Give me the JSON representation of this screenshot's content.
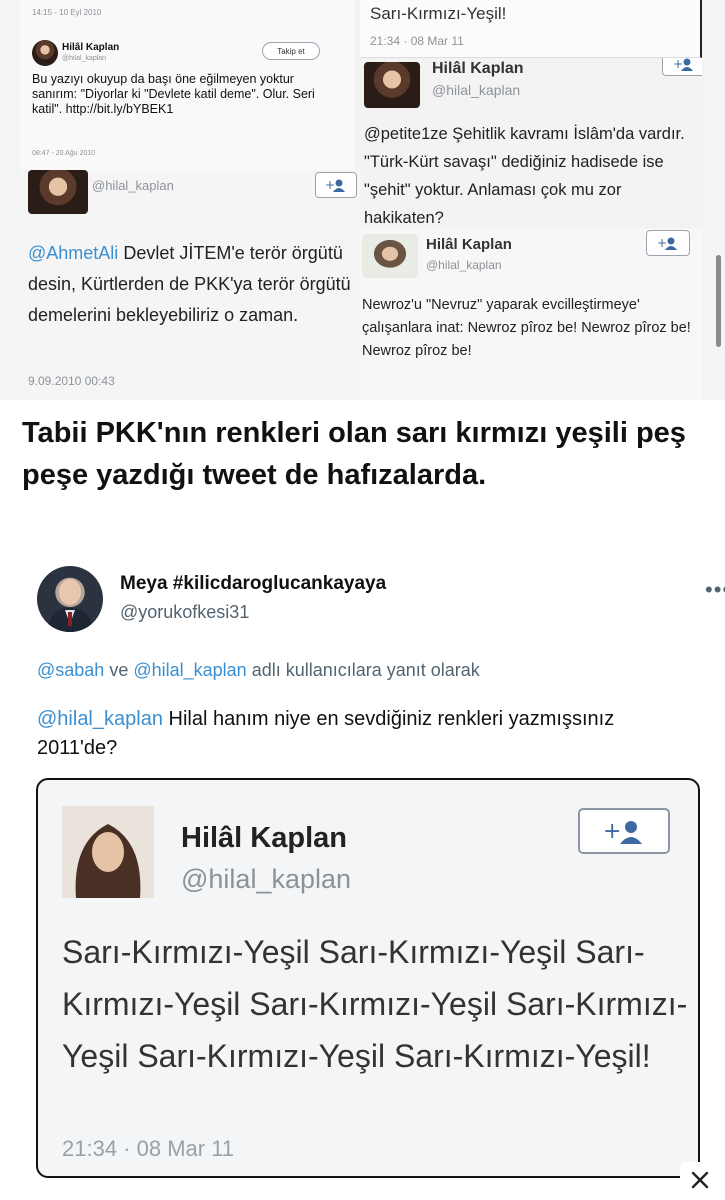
{
  "collage": {
    "top_left": {
      "meta": "14:15 - 10 Eyl 2010",
      "name": "Hilâl Kaplan",
      "handle": "@hilal_kaplan",
      "follow_label": "Takip et",
      "text": "Bu yazıyı okuyup da başı öne eğilmeyen yoktur sanırım: \"Diyorlar ki \"Devlete katil deme\". Olur. Seri katil\". http://bit.ly/bYBEK1",
      "time": "08:47 - 20 Ağu 2010"
    },
    "top_right_fragment": {
      "text": "Sarı-Kırmızı-Yeşil!",
      "time": "21:34 · 08 Mar 11"
    },
    "mid_left": {
      "handle": "@hilal_kaplan",
      "mention": "@AhmetAli",
      "text": " Devlet JİTEM'e terör örgütü desin, Kürtlerden de PKK'ya terör örgütü demelerini bekleyebiliriz o zaman.",
      "time": "9.09.2010 00:43"
    },
    "mid_right": {
      "name": "Hilâl Kaplan",
      "handle": "@hilal_kaplan",
      "mention": "@petite1ze",
      "text": " Şehitlik kavramı İslâm'da vardır. \"Türk-Kürt savaşı\" dediğiniz hadisede ise \"şehit\" yoktur. Anlaması çok mu zor hakikaten?"
    },
    "bottom_right": {
      "name": "Hilâl Kaplan",
      "handle": "@hilal_kaplan",
      "text": "Newroz'u \"Nevruz\" yaparak evcilleştirmeye' çalışanlara inat: Newroz pîroz be! Newroz pîroz be! Newroz pîroz be!"
    }
  },
  "caption": "Tabii PKK'nın renkleri olan sarı kırmızı yeşili peş peşe yazdığı tweet de hafızalarda.",
  "reply": {
    "display_name": "Meya #kilicdaroglucankayaya",
    "handle": "@yorukofkesi31",
    "more_label": "•••",
    "reply_to_1": "@sabah",
    "reply_to_sep": " ve ",
    "reply_to_2": "@hilal_kaplan",
    "reply_to_suffix": " adlı kullanıcılara yanıt olarak",
    "mention": "@hilal_kaplan",
    "text": " Hilal hanım niye en sevdiğiniz renkleri yazmışsınız 2011'de?"
  },
  "card": {
    "name": "Hilâl Kaplan",
    "handle": "@hilal_kaplan",
    "body": "Sarı-Kırmızı-Yeşil Sarı-Kırmızı-Yeşil Sarı-Kırmızı-Yeşil Sarı-Kırmızı-Yeşil Sarı-Kırmızı-Yeşil Sarı-Kırmızı-Yeşil Sarı-Kırmızı-Yeşil!",
    "time": "21:34 · 08 Mar 11"
  },
  "icons": {
    "follow": "add-user-icon",
    "more": "more-horizontal-icon",
    "close": "close-icon"
  },
  "colors": {
    "mention": "#3b8fd0",
    "muted": "#536471"
  }
}
